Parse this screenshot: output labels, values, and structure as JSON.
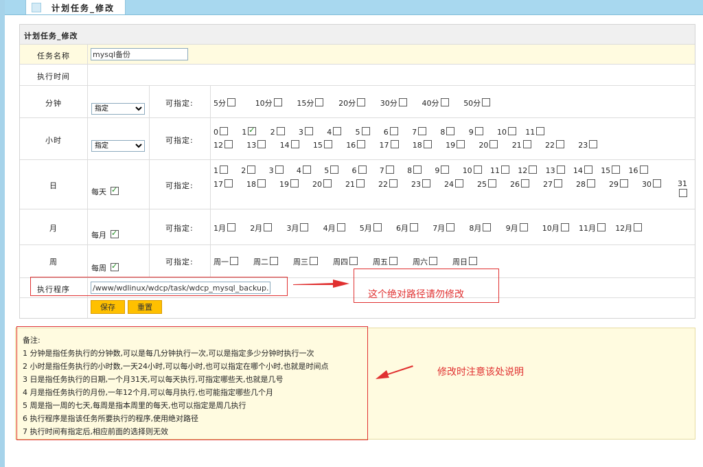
{
  "top_tab": {
    "title": "计划任务_修改"
  },
  "form": {
    "header": "计划任务_修改",
    "task_name": {
      "label": "任务名称",
      "value": "mysql备份"
    },
    "exec_time_label": "执行时间",
    "can_specify": "可指定:",
    "minute": {
      "label": "分钟",
      "select": "指定",
      "options": [
        {
          "label": "5分",
          "checked": false
        },
        {
          "label": "10分",
          "checked": false
        },
        {
          "label": "15分",
          "checked": false
        },
        {
          "label": "20分",
          "checked": false
        },
        {
          "label": "30分",
          "checked": false
        },
        {
          "label": "40分",
          "checked": false
        },
        {
          "label": "50分",
          "checked": false
        }
      ]
    },
    "hour": {
      "label": "小时",
      "select": "指定",
      "options": [
        {
          "label": "0",
          "checked": false
        },
        {
          "label": "1",
          "checked": true
        },
        {
          "label": "2",
          "checked": false
        },
        {
          "label": "3",
          "checked": false
        },
        {
          "label": "4",
          "checked": false
        },
        {
          "label": "5",
          "checked": false
        },
        {
          "label": "6",
          "checked": false
        },
        {
          "label": "7",
          "checked": false
        },
        {
          "label": "8",
          "checked": false
        },
        {
          "label": "9",
          "checked": false
        },
        {
          "label": "10",
          "checked": false
        },
        {
          "label": "11",
          "checked": false
        },
        {
          "label": "12",
          "checked": false
        },
        {
          "label": "13",
          "checked": false
        },
        {
          "label": "14",
          "checked": false
        },
        {
          "label": "15",
          "checked": false
        },
        {
          "label": "16",
          "checked": false
        },
        {
          "label": "17",
          "checked": false
        },
        {
          "label": "18",
          "checked": false
        },
        {
          "label": "19",
          "checked": false
        },
        {
          "label": "20",
          "checked": false
        },
        {
          "label": "21",
          "checked": false
        },
        {
          "label": "22",
          "checked": false
        },
        {
          "label": "23",
          "checked": false
        }
      ]
    },
    "day": {
      "label": "日",
      "every": {
        "label": "每天",
        "checked": true
      },
      "options": [
        {
          "label": "1"
        },
        {
          "label": "2"
        },
        {
          "label": "3"
        },
        {
          "label": "4"
        },
        {
          "label": "5"
        },
        {
          "label": "6"
        },
        {
          "label": "7"
        },
        {
          "label": "8"
        },
        {
          "label": "9"
        },
        {
          "label": "10"
        },
        {
          "label": "11"
        },
        {
          "label": "12"
        },
        {
          "label": "13"
        },
        {
          "label": "14"
        },
        {
          "label": "15"
        },
        {
          "label": "16"
        },
        {
          "label": "17"
        },
        {
          "label": "18"
        },
        {
          "label": "19"
        },
        {
          "label": "20"
        },
        {
          "label": "21"
        },
        {
          "label": "22"
        },
        {
          "label": "23"
        },
        {
          "label": "24"
        },
        {
          "label": "25"
        },
        {
          "label": "26"
        },
        {
          "label": "27"
        },
        {
          "label": "28"
        },
        {
          "label": "29"
        },
        {
          "label": "30"
        },
        {
          "label": "31"
        }
      ]
    },
    "month": {
      "label": "月",
      "every": {
        "label": "每月",
        "checked": true
      },
      "options": [
        {
          "label": "1月"
        },
        {
          "label": "2月"
        },
        {
          "label": "3月"
        },
        {
          "label": "4月"
        },
        {
          "label": "5月"
        },
        {
          "label": "6月"
        },
        {
          "label": "7月"
        },
        {
          "label": "8月"
        },
        {
          "label": "9月"
        },
        {
          "label": "10月"
        },
        {
          "label": "11月"
        },
        {
          "label": "12月"
        }
      ]
    },
    "week": {
      "label": "周",
      "every": {
        "label": "每周",
        "checked": true
      },
      "options": [
        {
          "label": "周一"
        },
        {
          "label": "周二"
        },
        {
          "label": "周三"
        },
        {
          "label": "周四"
        },
        {
          "label": "周五"
        },
        {
          "label": "周六"
        },
        {
          "label": "周日"
        }
      ]
    },
    "program": {
      "label": "执行程序",
      "value": "/www/wdlinux/wdcp/task/wdcp_mysql_backup.php"
    },
    "buttons": {
      "save": "保存",
      "reset": "重置"
    }
  },
  "annotations": {
    "path_note": "这个绝对路径请勿修改",
    "notes_note": "修改时注意该处说明",
    "color": "#e03030"
  },
  "notes": {
    "title": "备注:",
    "lines": [
      "1 分钟是指任务执行的分钟数,可以是每几分钟执行一次,可以是指定多少分钟时执行一次",
      "2 小时是指任务执行的小时数,一天24小时,可以每小时,也可以指定在哪个小时,也就是时间点",
      "3 日是指任务执行的日期,一个月31天,可以每天执行,可指定哪些天,也就是几号",
      "4 月是指任务执行的月份,一年12个月,可以每月执行,也可能指定哪些几个月",
      "5 周是指一周的七天,每周是指本周里的每天,也可以指定是周几执行",
      "6 执行程序是指该任务所要执行的程序,使用绝对路径",
      "7 执行时间有指定后,相应前面的选择则无效"
    ]
  },
  "colors": {
    "accent": "#a8d8ef",
    "button": "#ffc000",
    "highlight_row": "#fffbe0"
  }
}
